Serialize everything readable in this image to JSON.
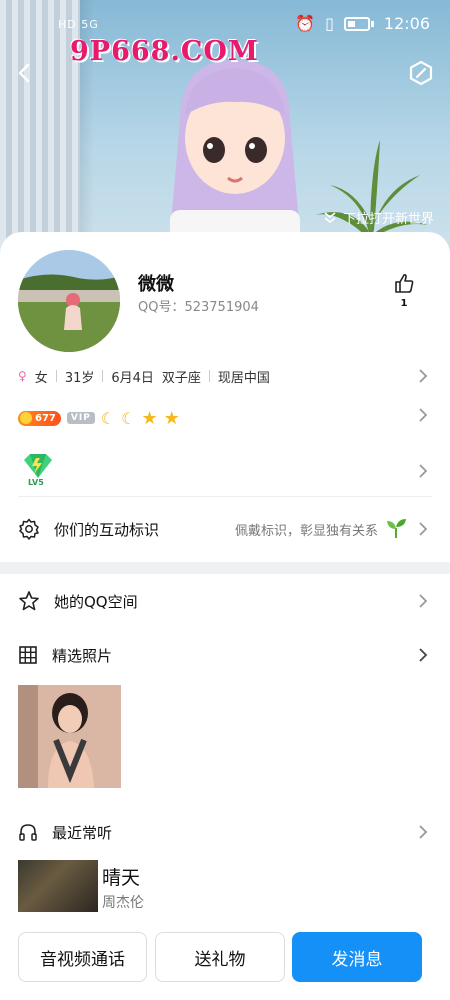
{
  "status_bar": {
    "left_text": "HD 5G",
    "time": "12:06"
  },
  "watermark": "9P668.COM",
  "header": {
    "pull_hint": "下拉打开新世界"
  },
  "profile": {
    "nickname": "微微",
    "qq_label": "QQ号：",
    "qq_number": "523751904",
    "likes": "1",
    "info": [
      "女",
      "31岁",
      "6月4日",
      "双子座",
      "现居中国"
    ],
    "sun_level": "677",
    "vip_label": "VIP",
    "level_badge": "LV5"
  },
  "interaction": {
    "title": "你们的互动标识",
    "hint": "佩戴标识，彰显独有关系"
  },
  "sections": {
    "qzone": "她的QQ空间",
    "photos": "精选照片",
    "music": "最近常听"
  },
  "song": {
    "title": "晴天",
    "artist": "周杰伦"
  },
  "buttons": {
    "call": "音视频通话",
    "gift": "送礼物",
    "message": "发消息"
  },
  "colors": {
    "accent": "#1590f7",
    "watermark": "#e9196b"
  }
}
